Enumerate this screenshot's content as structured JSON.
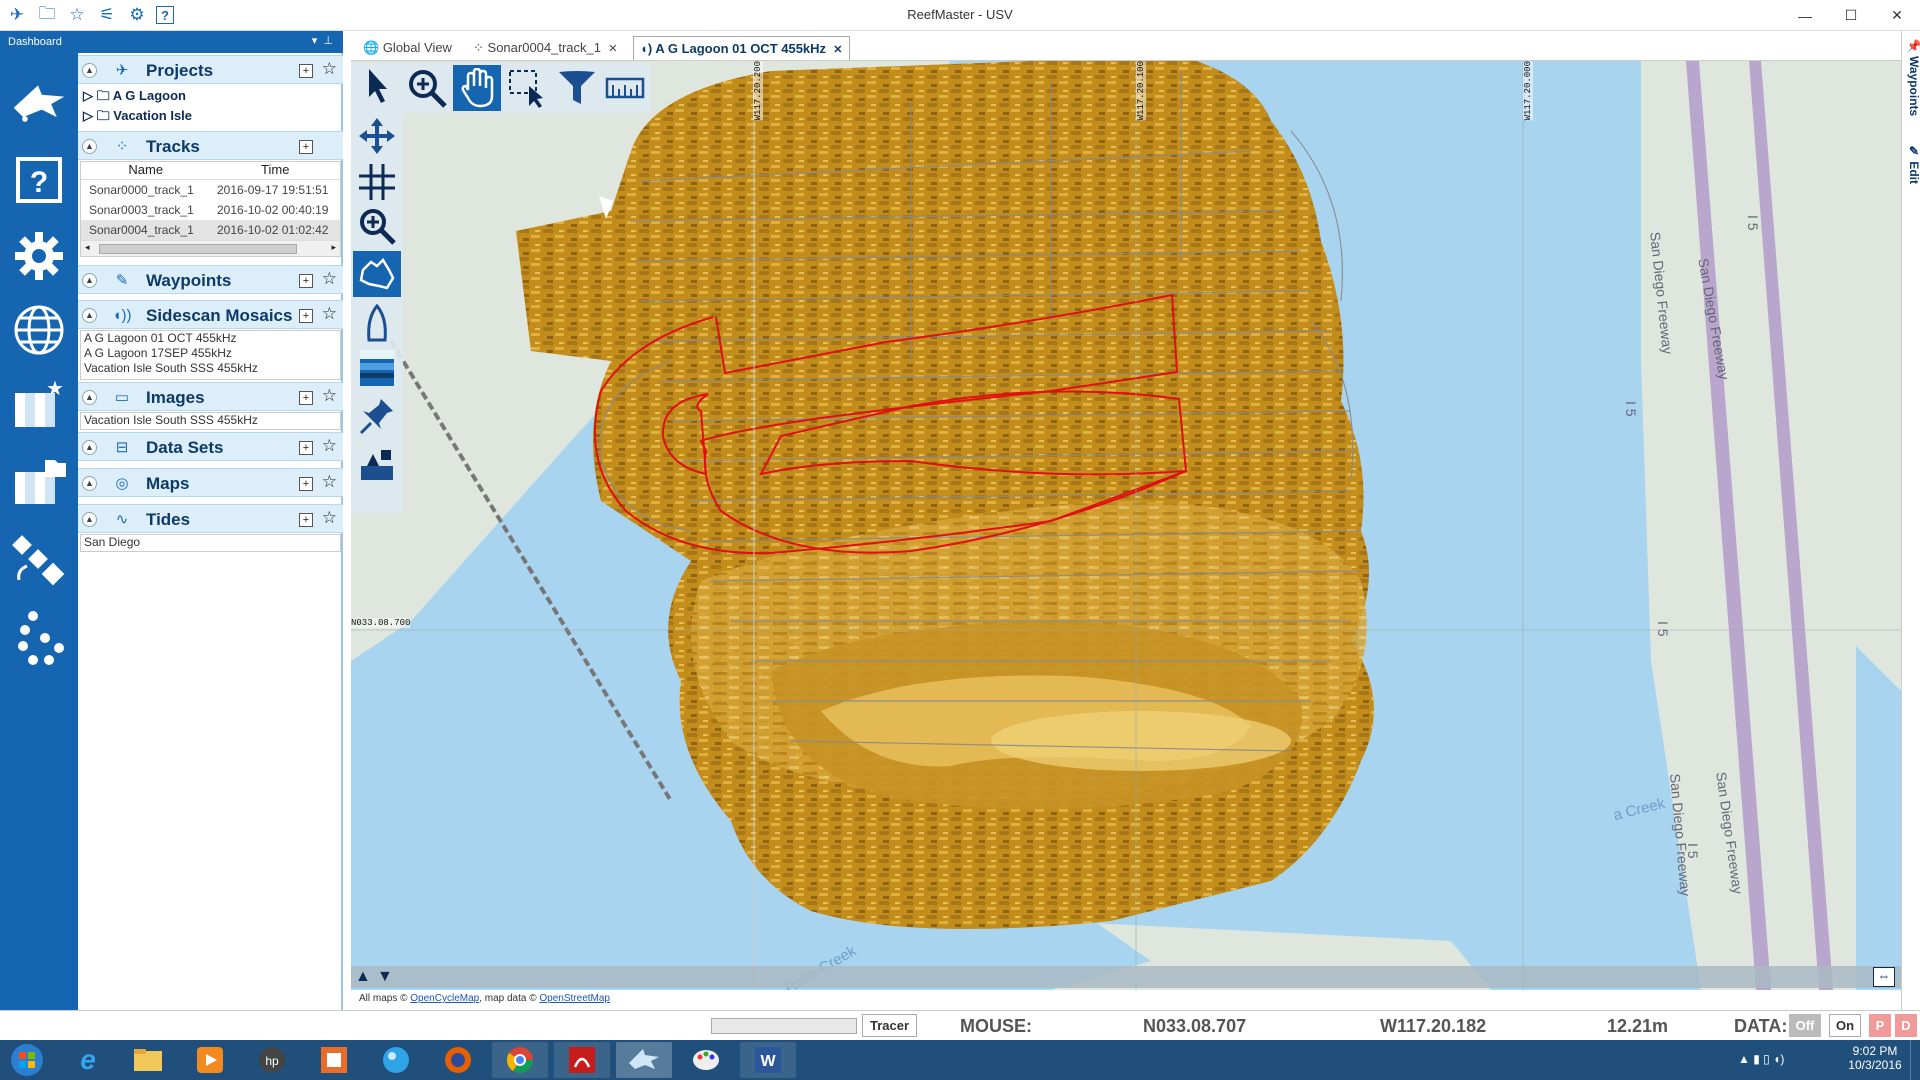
{
  "window": {
    "title": "ReefMaster - USV"
  },
  "dashboard": {
    "title": "Dashboard"
  },
  "sections": {
    "projects": {
      "label": "Projects",
      "items": [
        "A G Lagoon",
        "Vacation Isle"
      ]
    },
    "tracks": {
      "label": "Tracks",
      "columns": [
        "Name",
        "Time"
      ],
      "rows": [
        {
          "name": "Sonar0000_track_1",
          "time": "2016-09-17 19:51:51"
        },
        {
          "name": "Sonar0003_track_1",
          "time": "2016-10-02 00:40:19"
        },
        {
          "name": "Sonar0004_track_1",
          "time": "2016-10-02 01:02:42"
        }
      ]
    },
    "waypoints": {
      "label": "Waypoints"
    },
    "sidescan": {
      "label": "Sidescan Mosaics",
      "items": [
        "A G Lagoon 01 OCT 455kHz",
        "A G Lagoon 17SEP 455kHz",
        "Vacation Isle South SSS 455kHz"
      ]
    },
    "images": {
      "label": "Images",
      "items": [
        "Vacation Isle South SSS 455kHz"
      ]
    },
    "datasets": {
      "label": "Data Sets"
    },
    "maps": {
      "label": "Maps"
    },
    "tides": {
      "label": "Tides",
      "items": [
        "San Diego"
      ]
    }
  },
  "tabs": [
    {
      "label": "Global View"
    },
    {
      "label": "Sonar0004_track_1"
    },
    {
      "label": "A G Lagoon 01 OCT 455kHz"
    }
  ],
  "map": {
    "coords": [
      "W117.20.200",
      "W117.20.100",
      "W117.20.000",
      "N033.08.700"
    ],
    "labels": [
      "San Diego Freeway",
      "San Diego Freeway",
      "San Diego Freeway",
      "San Diego Freeway",
      "I 5",
      "I 5",
      "I 5",
      "I 5",
      "a Creek",
      "Rose Creek"
    ],
    "attribution_prefix": "All maps ©",
    "attribution_link1": "OpenCycleMap",
    "attribution_mid": ", map data ©",
    "attribution_link2": "OpenStreetMap"
  },
  "right_tabs": [
    "Waypoints",
    "Edit"
  ],
  "status": {
    "tracer": "Tracer",
    "mouse_label": "MOUSE:",
    "lat": "N033.08.707",
    "lon": "W117.20.182",
    "depth": "12.21m",
    "data_label": "DATA:",
    "off": "Off",
    "on": "On",
    "p": "P",
    "d": "D"
  },
  "clock": {
    "time": "9:02 PM",
    "date": "10/3/2016"
  },
  "colors": {
    "accent": "#1565b0",
    "panel_header": "#dbeefa",
    "sonar": "#c8921e",
    "track_outline": "#e01010",
    "water": "#a8d4f0"
  }
}
